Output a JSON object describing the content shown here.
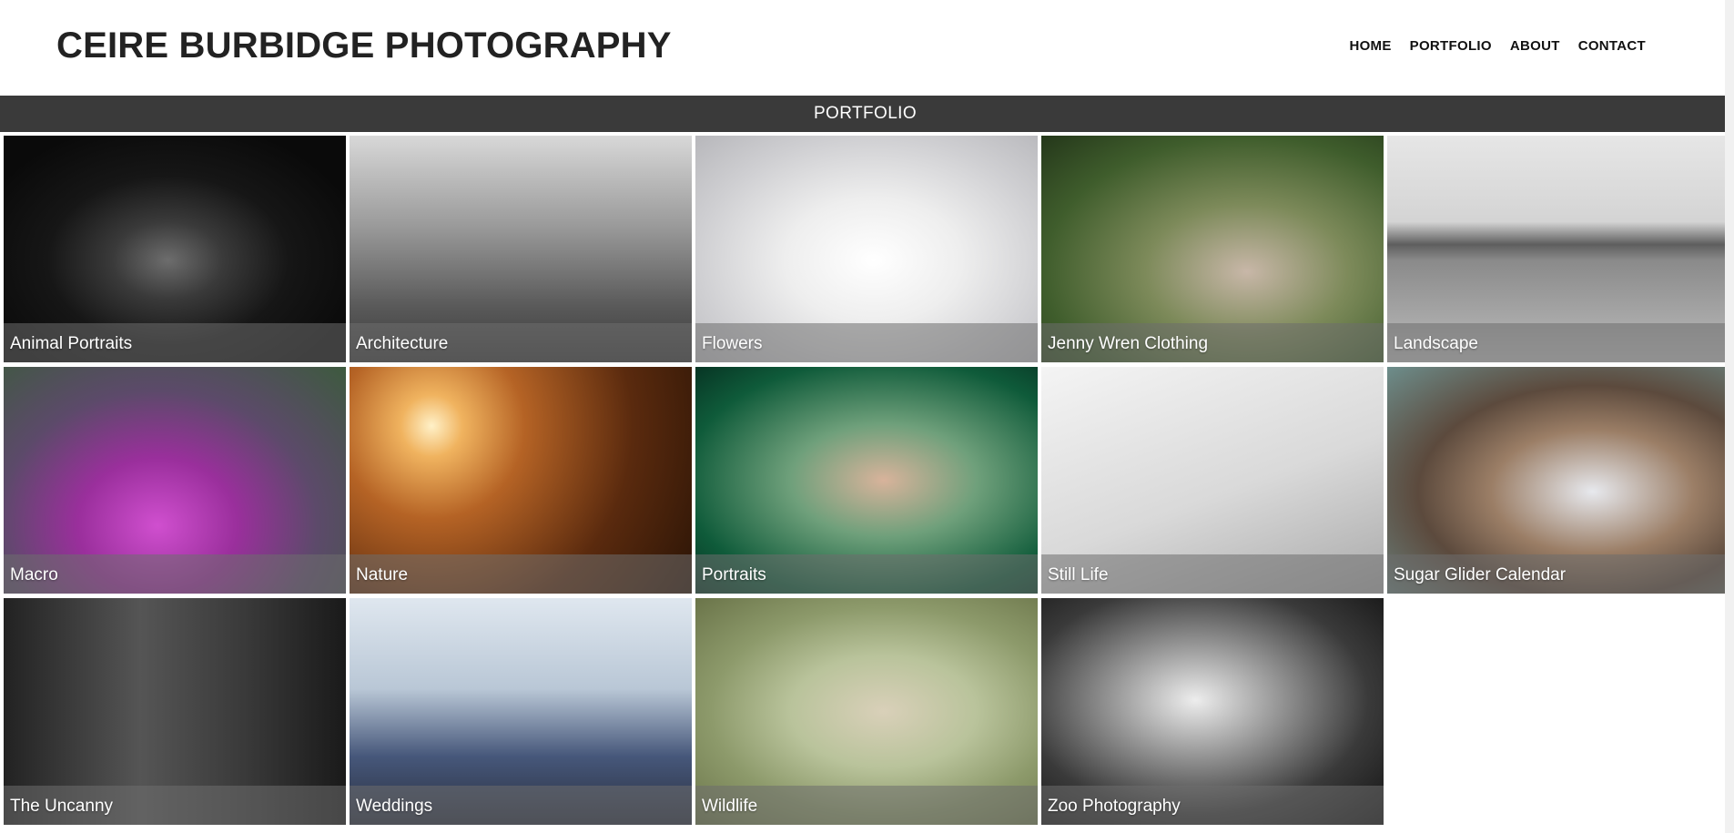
{
  "header": {
    "site_title": "CEIRE BURBIDGE PHOTOGRAPHY",
    "nav": [
      {
        "label": "HOME"
      },
      {
        "label": "PORTFOLIO"
      },
      {
        "label": "ABOUT"
      },
      {
        "label": "CONTACT"
      }
    ]
  },
  "banner": {
    "title": "PORTFOLIO"
  },
  "gallery": [
    {
      "caption": "Animal Portraits"
    },
    {
      "caption": "Architecture"
    },
    {
      "caption": "Flowers"
    },
    {
      "caption": "Jenny Wren Clothing"
    },
    {
      "caption": "Landscape"
    },
    {
      "caption": "Macro"
    },
    {
      "caption": "Nature"
    },
    {
      "caption": "Portraits"
    },
    {
      "caption": "Still Life"
    },
    {
      "caption": "Sugar Glider Calendar"
    },
    {
      "caption": "The Uncanny"
    },
    {
      "caption": "Weddings"
    },
    {
      "caption": "Wildlife"
    },
    {
      "caption": "Zoo Photography"
    }
  ]
}
